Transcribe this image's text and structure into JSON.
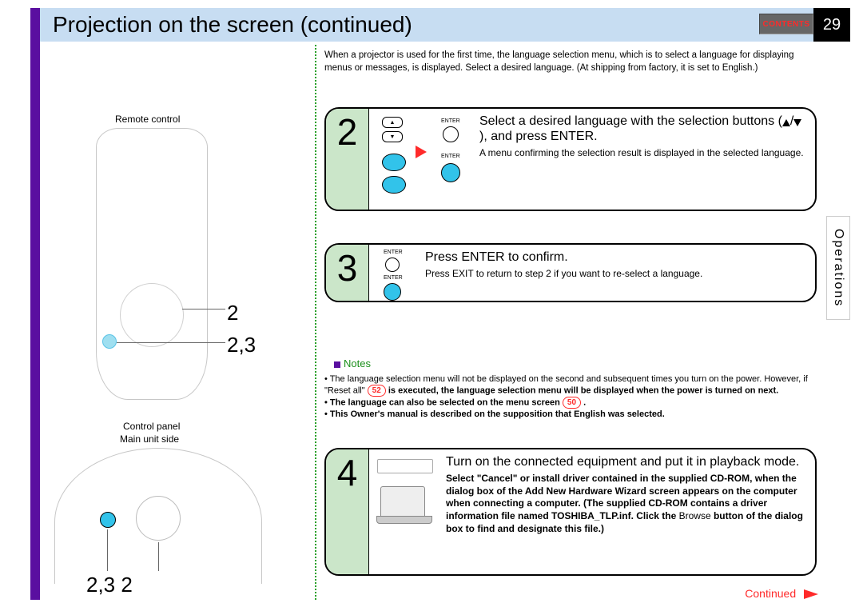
{
  "page_number": "29",
  "header": {
    "title": "Projection on the screen (continued)"
  },
  "contents_button": "CONTENTS",
  "side_tab": "Operations",
  "intro": "When a projector is used for the first time, the language selection menu, which is to select a language for displaying menus or messages, is displayed. Select a desired language. (At shipping from factory, it is set to English.)",
  "left": {
    "remote_label": "Remote control",
    "callout_2": "2",
    "callout_23": "2,3",
    "control_label1": "Control panel",
    "control_label2": "Main unit side",
    "panel_callout": "2,3  2"
  },
  "steps": {
    "s2": {
      "num": "2",
      "title_a": "Select a desired language with the selection buttons (",
      "title_b": "), and press ENTER.",
      "sub": "A menu confirming the selection result is displayed in the selected language.",
      "enter": "ENTER"
    },
    "s3": {
      "num": "3",
      "title": "Press ENTER to confirm.",
      "sub": "Press EXIT to return to step 2 if you want to re-select a language.",
      "enter": "ENTER"
    },
    "s4": {
      "num": "4",
      "title": "Turn on the connected equipment and put it in playback mode.",
      "sub_a": "Select \"Cancel\" or install driver contained in the supplied CD-ROM, when the dialog box of the Add New Hardware Wizard screen appears on the computer when connecting a computer. (The supplied CD-ROM contains a driver information file named TOSHIBA_TLP.inf. Click the ",
      "sub_browse": "Browse",
      "sub_b": " button of the dialog box to find and designate this file.)"
    }
  },
  "notes": {
    "head": "Notes",
    "line1a": "• The language selection menu will not be displayed on the second and subsequent times you turn on the power. However, if \"Reset all\" ",
    "ref52": "52",
    "line1b": " is executed, the language selection menu will be displayed when the power is turned on next.",
    "line2a": "• The language can also be selected on the menu screen ",
    "ref50": "50",
    "line2b": ".",
    "line3": "• This Owner's manual is described on the supposition that English was selected."
  },
  "continued": "Continued"
}
